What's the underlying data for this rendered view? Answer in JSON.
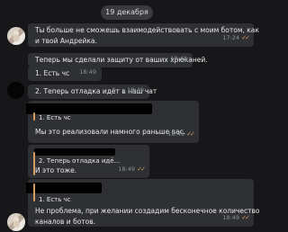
{
  "date": "19 декабря",
  "messages": {
    "m1": {
      "line1": "Ты больше не сможешь взаимодействовать с моим ботом, как",
      "line2": "и твой Андрейка.",
      "time": "17:24"
    },
    "m2": {
      "text": "Теперь мы сделали защиту от ваших хрюканей.",
      "time": "18:48"
    },
    "m3": {
      "text": "1. Есть чс",
      "time": "18:49"
    },
    "m4": {
      "text": "2. Теперь отладка идёт в наш чат",
      "time": "18:49"
    },
    "m5": {
      "quote": "1. Есть чс",
      "text": "Мы это реализовали намного раньше вас.",
      "time": "18:49"
    },
    "m6": {
      "quote": "2. Теперь отладка идё...",
      "text": "И это тоже.",
      "time": "18:49"
    },
    "m7": {
      "quote": "1. Есть чс",
      "line1": "Не проблема, при желании создадим бесконечное количество",
      "line2": "каналов и ботов.",
      "time": "18:49"
    }
  },
  "colors": {
    "background": "#17171a",
    "bubble": "#2f3034",
    "accent": "#d59b62"
  },
  "icons": {
    "read_receipt": "double-check-icon",
    "avatar_top": "avatar-image",
    "avatar_middle": "avatar-dark-circle",
    "avatar_bottom": "avatar-image"
  }
}
